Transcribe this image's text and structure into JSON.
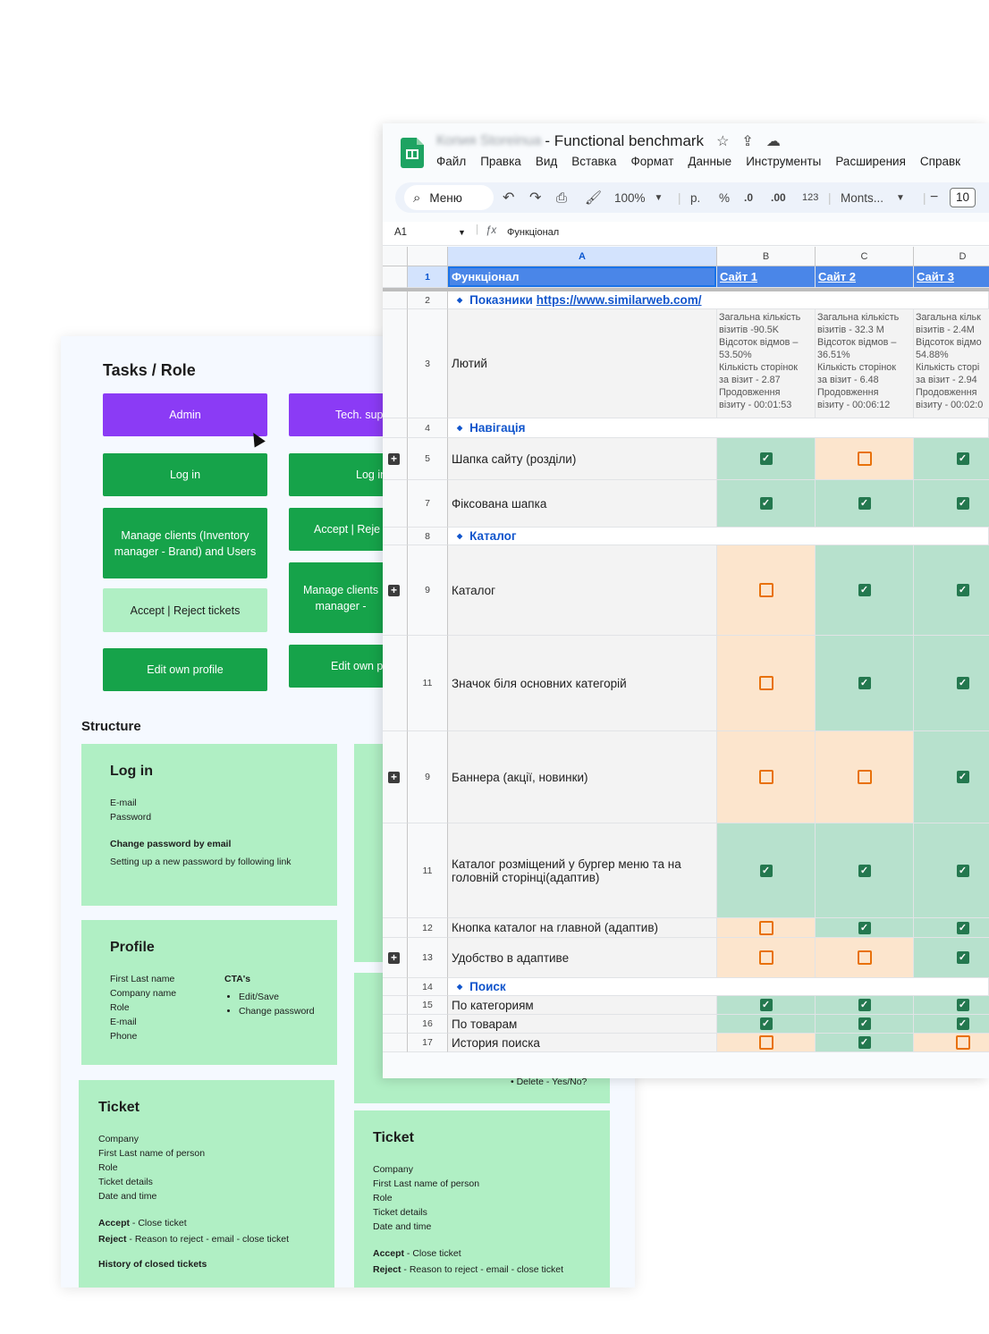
{
  "board": {
    "title": "Tasks / Role",
    "tiles_left": [
      "Admin",
      "Log in",
      "Manage clients (Inventory manager - Brand) and Users",
      "Accept | Reject tickets",
      "Edit own profile"
    ],
    "tiles_right": [
      "Tech. sup",
      "Log in",
      "Accept | Reje",
      "Manage clients\nmanager -",
      "Edit own p"
    ],
    "structure_title": "Structure",
    "login_card": {
      "title": "Log in",
      "fields": [
        "E-mail",
        "Password"
      ],
      "sub_title": "Change password by email",
      "sub_text": "Setting up a new password by following link"
    },
    "profile_card": {
      "title": "Profile",
      "fields": [
        "First Last name",
        "Company name",
        "Role",
        "E-mail",
        "Phone"
      ],
      "cta_title": "CTA's",
      "ctas": [
        "Edit/Save",
        "Change password"
      ]
    },
    "ticket_card_left": {
      "title": "Ticket",
      "fields": [
        "Company",
        "First Last name of person",
        "Role",
        "Ticket details",
        "Date and time"
      ],
      "accept_label": "Accept",
      "accept_text": " - Close ticket",
      "reject_label": "Reject",
      "reject_text": " - Reason to reject - email - close ticket",
      "history": "History of closed tickets"
    },
    "ticket_card_right": {
      "title": "Ticket",
      "fields": [
        "Company",
        "First Last name of person",
        "Role",
        "Ticket details",
        "Date and time"
      ],
      "accept_label": "Accept",
      "accept_text": " - Close ticket",
      "reject_label": "Reject",
      "reject_text": " - Reason to reject - email - close ticket"
    },
    "partial_text": "• Delete - Yes/No?"
  },
  "sheet": {
    "blurred_owner": "Копия Storeinua",
    "title": " - Functional benchmark",
    "menu": [
      "Файл",
      "Правка",
      "Вид",
      "Вставка",
      "Формат",
      "Данные",
      "Инструменты",
      "Расширения",
      "Справк"
    ],
    "toolbar": {
      "menu_label": "Меню",
      "zoom": "100%",
      "currency": "р.",
      "percent": "%",
      "dec_minus": ".0",
      "dec_plus": ".00",
      "num": "123",
      "font": "Monts...",
      "font_size": "10"
    },
    "cell_ref": "A1",
    "formula": "Функціонал",
    "columns": [
      "A",
      "B",
      "C",
      "D"
    ],
    "header": {
      "num": "1",
      "name": "Функціонал",
      "sites": [
        "Сайт 1",
        "Сайт 2",
        "Сайт 3"
      ]
    },
    "rows": [
      {
        "type": "section",
        "num": "2",
        "label": "Показники",
        "link": "https://www.similarweb.com/"
      },
      {
        "type": "stats",
        "num": "3",
        "label": "Лютий",
        "stats": [
          "Загальна кількість\nвізитів -90.5K\nВідсоток відмов –\n53.50%\nКількість сторінок\nза візит - 2.87\nПродовження\nвізиту - 00:01:53",
          "Загальна кількість\nвізитів - 32.3 M\nВідсоток відмов –\n36.51%\nКількість сторінок\nза візит - 6.48\nПродовження\nвізиту - 00:06:12",
          "Загальна кільк\nвізитів - 2.4M\nВідсоток відмо\n54.88%\nКількість сторі\nза візит - 2.94\nПродовження\nвізиту - 00:02:0"
        ]
      },
      {
        "type": "section",
        "num": "4",
        "label": "Навігація"
      },
      {
        "type": "check",
        "num": "5",
        "label": "Шапка сайту (розділи)",
        "values": [
          true,
          false,
          true
        ],
        "plus": true
      },
      {
        "type": "check",
        "num": "7",
        "label": "Фіксована шапка",
        "values": [
          true,
          true,
          true
        ]
      },
      {
        "type": "section",
        "num": "8",
        "label": "Каталог"
      },
      {
        "type": "check",
        "num": "9",
        "label": "Каталог",
        "values": [
          false,
          true,
          true
        ],
        "plus": true
      },
      {
        "type": "check",
        "num": "11",
        "label": "Значок біля основних категорій",
        "values": [
          false,
          true,
          true
        ]
      },
      {
        "type": "check",
        "num": "9",
        "label": "Баннера (акції, новинки)",
        "values": [
          false,
          false,
          true
        ],
        "plus": true
      },
      {
        "type": "check",
        "num": "11",
        "label": "Каталог розміщений у бургер меню та на головній сторінці(адаптив)",
        "values": [
          true,
          true,
          true
        ]
      },
      {
        "type": "check",
        "num": "12",
        "label": "Кнопка каталог на главной  (адаптив)",
        "values": [
          false,
          true,
          true
        ]
      },
      {
        "type": "check",
        "num": "13",
        "label": "Удобство в адаптиве",
        "values": [
          false,
          false,
          true
        ],
        "plus": true
      },
      {
        "type": "section",
        "num": "14",
        "label": "Поиск"
      },
      {
        "type": "check",
        "num": "15",
        "label": "По категориям",
        "values": [
          true,
          true,
          true
        ]
      },
      {
        "type": "check",
        "num": "16",
        "label": "По товарам",
        "values": [
          true,
          true,
          true
        ]
      },
      {
        "type": "check",
        "num": "17",
        "label": "История поиска",
        "values": [
          false,
          true,
          false
        ]
      }
    ]
  }
}
